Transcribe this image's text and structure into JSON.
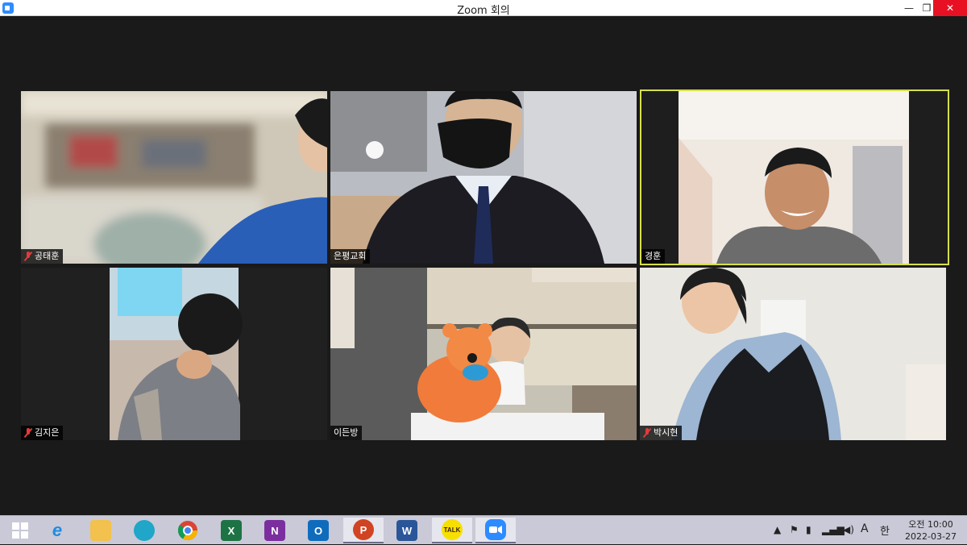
{
  "window": {
    "title": "Zoom 회의",
    "minimize": "—",
    "maximize": "❐",
    "close": "✕"
  },
  "participants": [
    {
      "name": "공태훈",
      "muted": true
    },
    {
      "name": "은평교회",
      "muted": false
    },
    {
      "name": "경훈",
      "muted": false,
      "active_speaker": true
    },
    {
      "name": "김지은",
      "muted": true
    },
    {
      "name": "이든방",
      "muted": false
    },
    {
      "name": "박시현",
      "muted": true
    }
  ],
  "taskbar": {
    "apps": [
      {
        "icon": "start-icon",
        "label": ""
      },
      {
        "icon": "internet-explorer-icon",
        "label": "e"
      },
      {
        "icon": "file-explorer-icon",
        "label": ""
      },
      {
        "icon": "edge-icon",
        "label": ""
      },
      {
        "icon": "chrome-icon",
        "label": ""
      },
      {
        "icon": "excel-icon",
        "label": "X"
      },
      {
        "icon": "onenote-icon",
        "label": "N"
      },
      {
        "icon": "outlook-icon",
        "label": "O"
      },
      {
        "icon": "powerpoint-icon",
        "label": "P"
      },
      {
        "icon": "word-icon",
        "label": "W"
      },
      {
        "icon": "kakaotalk-icon",
        "label": "TALK"
      },
      {
        "icon": "zoom-icon",
        "label": ""
      }
    ],
    "tray": {
      "ime_mode": "A",
      "ime_lang": "한",
      "time": "오전 10:00",
      "date": "2022-03-27"
    }
  },
  "colors": {
    "active_speaker": "#d6e04a",
    "close_button": "#e81123",
    "muted": "#e23b3b"
  }
}
